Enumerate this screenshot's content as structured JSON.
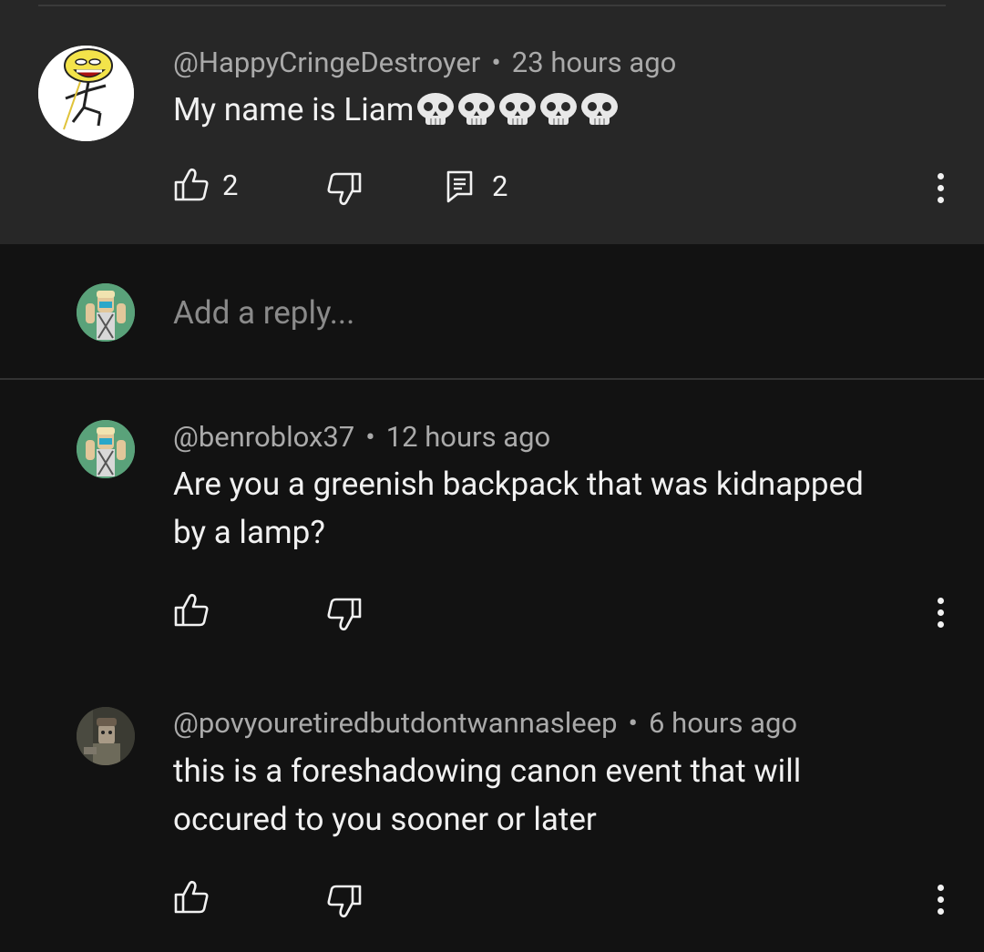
{
  "top_comment": {
    "handle": "@HappyCringeDestroyer",
    "time": "23 hours ago",
    "text": "My name is Liam",
    "emoji": "💀💀💀💀💀",
    "like_count": "2",
    "reply_count": "2"
  },
  "reply_box": {
    "placeholder": "Add a reply..."
  },
  "replies": [
    {
      "handle": "@benroblox37",
      "time": "12 hours ago",
      "text_line1": "Are you a greenish backpack that was kidnapped",
      "text_line2": "by a lamp?"
    },
    {
      "handle": "@povyouretiredbutdontwannasleep",
      "time": "6 hours ago",
      "text_line1": "this is a foreshadowing canon event that will",
      "text_line2": "occured to you sooner or later"
    }
  ],
  "separator": "•",
  "colors": {
    "background": "#121212",
    "highlight": "#272727",
    "text": "#f1f1f1",
    "meta": "#aaaaaa"
  }
}
